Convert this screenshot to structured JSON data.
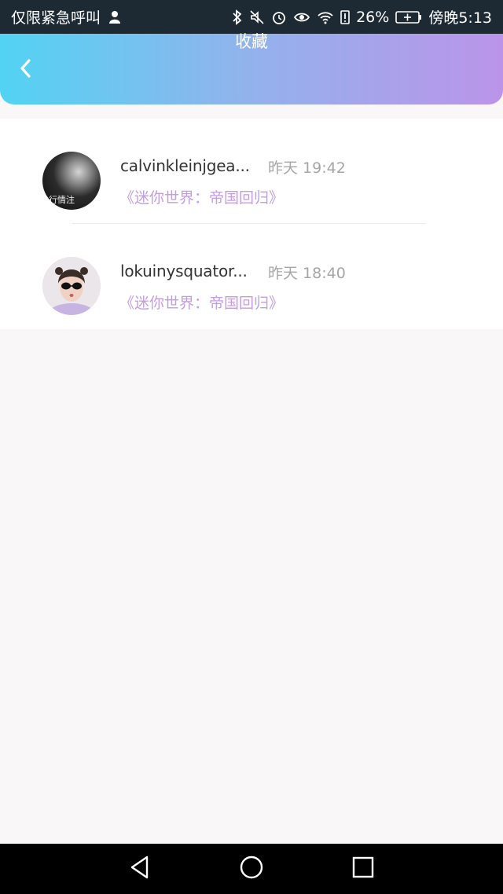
{
  "status_bar": {
    "carrier": "仅限紧急呼叫",
    "battery": "26%",
    "time": "傍晚5:13",
    "icons": [
      "user-silhouette-icon",
      "bluetooth-icon",
      "mute-icon",
      "alarm-icon",
      "eye-icon",
      "wifi-icon",
      "battery-alert-icon",
      "battery-icon"
    ]
  },
  "header": {
    "title": "收藏",
    "back_icon": "chevron-left-icon",
    "gradient": [
      "#52d3f3",
      "#bb94e9"
    ]
  },
  "favorites": [
    {
      "username": "calvinkleinjgea...",
      "time": "昨天 19:42",
      "book": "《迷你世界：帝国回归》",
      "avatar_text": "行情注"
    },
    {
      "username": "lokuinysquator...",
      "time": "昨天 18:40",
      "book": "《迷你世界：帝国回归》"
    }
  ],
  "nav_bar": {
    "buttons": [
      "nav-back-icon",
      "nav-home-icon",
      "nav-recents-icon"
    ]
  },
  "colors": {
    "accent_text": "#c29ee0",
    "time_text": "#a6a6a6",
    "username_text": "#333333"
  }
}
